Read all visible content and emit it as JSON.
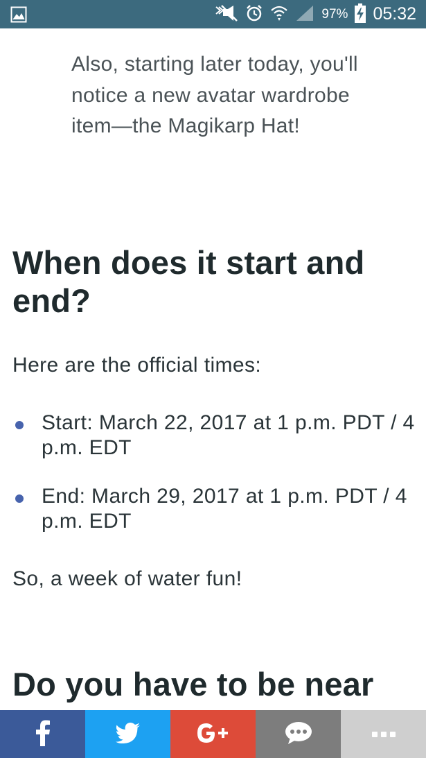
{
  "status_bar": {
    "battery": "97%",
    "time": "05:32",
    "icons": [
      "gallery-icon",
      "mute-icon",
      "alarm-icon",
      "wifi-icon",
      "signal-icon",
      "battery-charging-icon"
    ]
  },
  "article": {
    "quote": "Also, starting later today, you'll notice a new avatar wardrobe item—the Magikarp Hat!",
    "heading1": "When does it start and end?",
    "intro": "Here are the official times:",
    "bullets": [
      "Start: March 22, 2017 at 1 p.m. PDT / 4 p.m. EDT",
      "End: March 29, 2017 at 1 p.m. PDT / 4 p.m. EDT"
    ],
    "closing": "So, a week of water fun!",
    "heading2": "Do you have to be near"
  },
  "share_bar": {
    "buttons": [
      {
        "name": "facebook",
        "label": "f",
        "color": "#3b5a99"
      },
      {
        "name": "twitter",
        "label": "",
        "color": "#1da1f2"
      },
      {
        "name": "google-plus",
        "label": "G+",
        "color": "#dd4b39"
      },
      {
        "name": "sms",
        "label": "",
        "color": "#7d7d7d"
      },
      {
        "name": "more",
        "label": "",
        "color": "#cfcfcf"
      }
    ]
  }
}
